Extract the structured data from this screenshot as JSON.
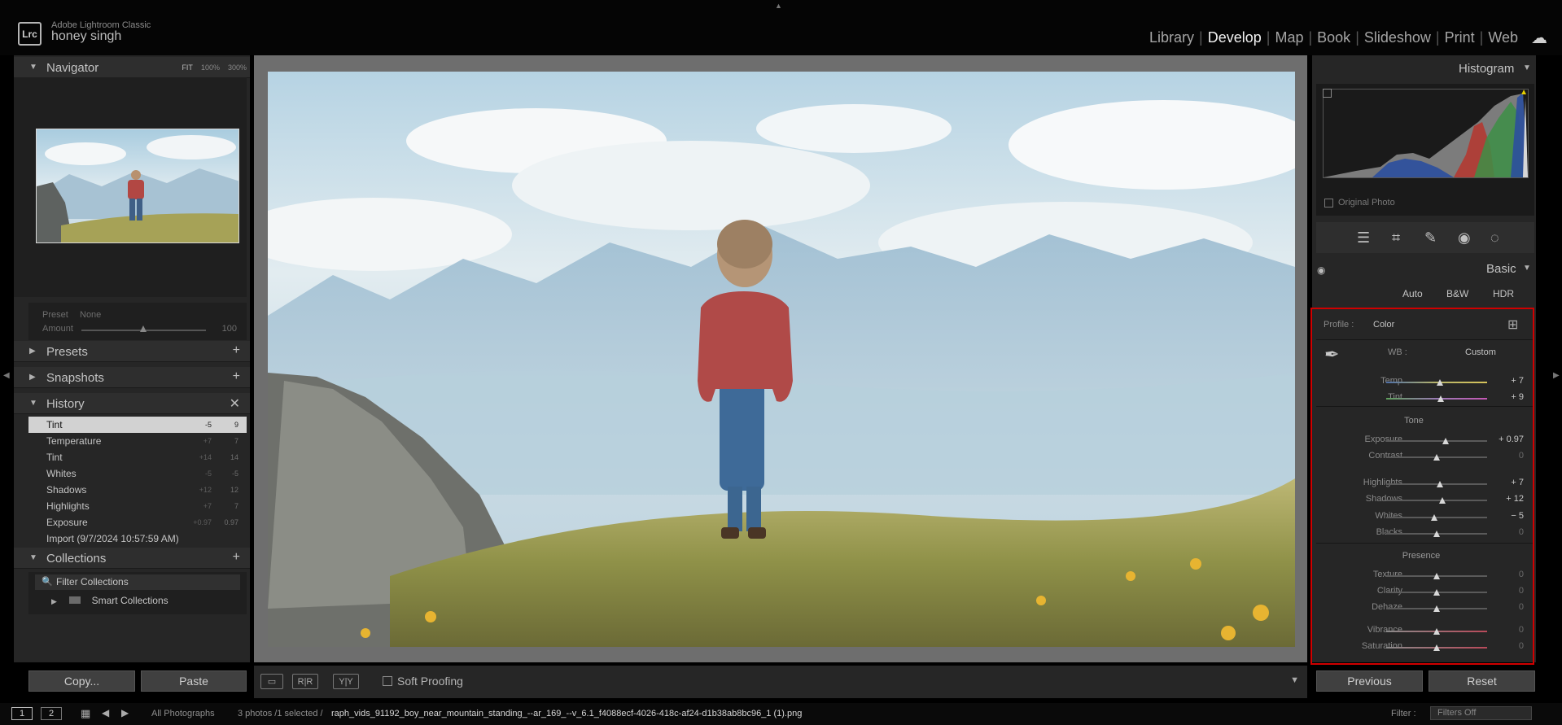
{
  "app": {
    "name": "Adobe Lightroom Classic",
    "logo": "Lrc",
    "user": "honey singh"
  },
  "modules": [
    "Library",
    "Develop",
    "Map",
    "Book",
    "Slideshow",
    "Print",
    "Web"
  ],
  "active_module": "Develop",
  "navigator": {
    "title": "Navigator",
    "fit": "FIT",
    "z1": "100%",
    "z2": "300%"
  },
  "preset": {
    "preset_label": "Preset",
    "preset_value": "None",
    "amount_label": "Amount",
    "amount_value": "100"
  },
  "left_panels": {
    "presets": "Presets",
    "snapshots": "Snapshots",
    "history": "History",
    "collections": "Collections"
  },
  "history": [
    {
      "name": "Tint",
      "a": "-5",
      "b": "9",
      "selected": true
    },
    {
      "name": "Temperature",
      "a": "+7",
      "b": "7"
    },
    {
      "name": "Tint",
      "a": "+14",
      "b": "14"
    },
    {
      "name": "Whites",
      "a": "-5",
      "b": "-5"
    },
    {
      "name": "Shadows",
      "a": "+12",
      "b": "12"
    },
    {
      "name": "Highlights",
      "a": "+7",
      "b": "7"
    },
    {
      "name": "Exposure",
      "a": "+0.97",
      "b": "0.97"
    },
    {
      "name": "Import (9/7/2024 10:57:59 AM)",
      "a": "",
      "b": ""
    }
  ],
  "collections": {
    "filter": "Filter Collections",
    "smart": "Smart Collections"
  },
  "left_buttons": {
    "copy": "Copy...",
    "paste": "Paste"
  },
  "toolbar": {
    "soft_proofing": "Soft Proofing"
  },
  "right": {
    "histogram": "Histogram",
    "original_photo": "Original Photo",
    "basic": "Basic",
    "auto": "Auto",
    "bw": "B&W",
    "hdr": "HDR",
    "profile_label": "Profile :",
    "profile_value": "Color",
    "wb_label": "WB :",
    "wb_value": "Custom",
    "tone": "Tone",
    "presence": "Presence"
  },
  "sliders": [
    {
      "label": "Temp",
      "value": "+ 7",
      "pos": 0.53
    },
    {
      "label": "Tint",
      "value": "+ 9",
      "pos": 0.54
    },
    {
      "label": "Exposure",
      "value": "+ 0.97",
      "pos": 0.59
    },
    {
      "label": "Contrast",
      "value": "0",
      "pos": 0.5
    },
    {
      "label": "Highlights",
      "value": "+ 7",
      "pos": 0.535
    },
    {
      "label": "Shadows",
      "value": "+ 12",
      "pos": 0.56
    },
    {
      "label": "Whites",
      "value": "− 5",
      "pos": 0.475
    },
    {
      "label": "Blacks",
      "value": "0",
      "pos": 0.5
    },
    {
      "label": "Texture",
      "value": "0",
      "pos": 0.5
    },
    {
      "label": "Clarity",
      "value": "0",
      "pos": 0.5
    },
    {
      "label": "Dehaze",
      "value": "0",
      "pos": 0.5
    },
    {
      "label": "Vibrance",
      "value": "0",
      "pos": 0.5
    },
    {
      "label": "Saturation",
      "value": "0",
      "pos": 0.5
    }
  ],
  "right_buttons": {
    "previous": "Previous",
    "reset": "Reset"
  },
  "filmstrip": {
    "page1": "1",
    "page2": "2",
    "source": "All Photographs",
    "count": "3 photos /1 selected /",
    "filename": "raph_vids_91192_boy_near_mountain_standing_--ar_169_--v_6.1_f4088ecf-4026-418c-af24-d1b38ab8bc96_1 (1).png",
    "filter_label": "Filter :",
    "filter_value": "Filters Off"
  }
}
